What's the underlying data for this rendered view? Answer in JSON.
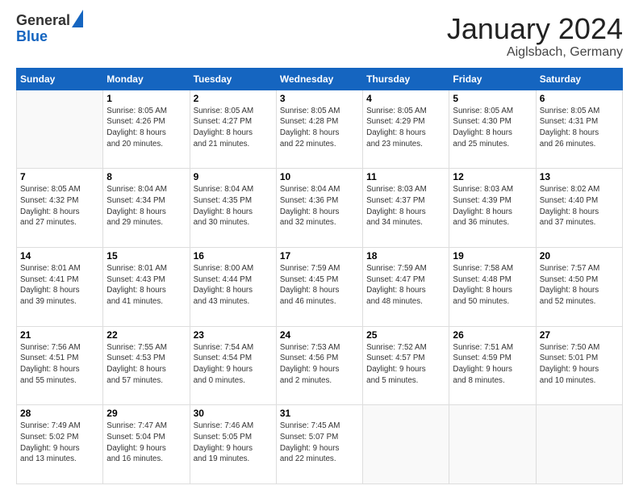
{
  "header": {
    "logo": {
      "general": "General",
      "blue": "Blue"
    },
    "title": "January 2024",
    "location": "Aiglsbach, Germany"
  },
  "weekdays": [
    "Sunday",
    "Monday",
    "Tuesday",
    "Wednesday",
    "Thursday",
    "Friday",
    "Saturday"
  ],
  "weeks": [
    [
      {
        "day": null,
        "info": null
      },
      {
        "day": "1",
        "info": "Sunrise: 8:05 AM\nSunset: 4:26 PM\nDaylight: 8 hours\nand 20 minutes."
      },
      {
        "day": "2",
        "info": "Sunrise: 8:05 AM\nSunset: 4:27 PM\nDaylight: 8 hours\nand 21 minutes."
      },
      {
        "day": "3",
        "info": "Sunrise: 8:05 AM\nSunset: 4:28 PM\nDaylight: 8 hours\nand 22 minutes."
      },
      {
        "day": "4",
        "info": "Sunrise: 8:05 AM\nSunset: 4:29 PM\nDaylight: 8 hours\nand 23 minutes."
      },
      {
        "day": "5",
        "info": "Sunrise: 8:05 AM\nSunset: 4:30 PM\nDaylight: 8 hours\nand 25 minutes."
      },
      {
        "day": "6",
        "info": "Sunrise: 8:05 AM\nSunset: 4:31 PM\nDaylight: 8 hours\nand 26 minutes."
      }
    ],
    [
      {
        "day": "7",
        "info": "Sunrise: 8:05 AM\nSunset: 4:32 PM\nDaylight: 8 hours\nand 27 minutes."
      },
      {
        "day": "8",
        "info": "Sunrise: 8:04 AM\nSunset: 4:34 PM\nDaylight: 8 hours\nand 29 minutes."
      },
      {
        "day": "9",
        "info": "Sunrise: 8:04 AM\nSunset: 4:35 PM\nDaylight: 8 hours\nand 30 minutes."
      },
      {
        "day": "10",
        "info": "Sunrise: 8:04 AM\nSunset: 4:36 PM\nDaylight: 8 hours\nand 32 minutes."
      },
      {
        "day": "11",
        "info": "Sunrise: 8:03 AM\nSunset: 4:37 PM\nDaylight: 8 hours\nand 34 minutes."
      },
      {
        "day": "12",
        "info": "Sunrise: 8:03 AM\nSunset: 4:39 PM\nDaylight: 8 hours\nand 36 minutes."
      },
      {
        "day": "13",
        "info": "Sunrise: 8:02 AM\nSunset: 4:40 PM\nDaylight: 8 hours\nand 37 minutes."
      }
    ],
    [
      {
        "day": "14",
        "info": "Sunrise: 8:01 AM\nSunset: 4:41 PM\nDaylight: 8 hours\nand 39 minutes."
      },
      {
        "day": "15",
        "info": "Sunrise: 8:01 AM\nSunset: 4:43 PM\nDaylight: 8 hours\nand 41 minutes."
      },
      {
        "day": "16",
        "info": "Sunrise: 8:00 AM\nSunset: 4:44 PM\nDaylight: 8 hours\nand 43 minutes."
      },
      {
        "day": "17",
        "info": "Sunrise: 7:59 AM\nSunset: 4:45 PM\nDaylight: 8 hours\nand 46 minutes."
      },
      {
        "day": "18",
        "info": "Sunrise: 7:59 AM\nSunset: 4:47 PM\nDaylight: 8 hours\nand 48 minutes."
      },
      {
        "day": "19",
        "info": "Sunrise: 7:58 AM\nSunset: 4:48 PM\nDaylight: 8 hours\nand 50 minutes."
      },
      {
        "day": "20",
        "info": "Sunrise: 7:57 AM\nSunset: 4:50 PM\nDaylight: 8 hours\nand 52 minutes."
      }
    ],
    [
      {
        "day": "21",
        "info": "Sunrise: 7:56 AM\nSunset: 4:51 PM\nDaylight: 8 hours\nand 55 minutes."
      },
      {
        "day": "22",
        "info": "Sunrise: 7:55 AM\nSunset: 4:53 PM\nDaylight: 8 hours\nand 57 minutes."
      },
      {
        "day": "23",
        "info": "Sunrise: 7:54 AM\nSunset: 4:54 PM\nDaylight: 9 hours\nand 0 minutes."
      },
      {
        "day": "24",
        "info": "Sunrise: 7:53 AM\nSunset: 4:56 PM\nDaylight: 9 hours\nand 2 minutes."
      },
      {
        "day": "25",
        "info": "Sunrise: 7:52 AM\nSunset: 4:57 PM\nDaylight: 9 hours\nand 5 minutes."
      },
      {
        "day": "26",
        "info": "Sunrise: 7:51 AM\nSunset: 4:59 PM\nDaylight: 9 hours\nand 8 minutes."
      },
      {
        "day": "27",
        "info": "Sunrise: 7:50 AM\nSunset: 5:01 PM\nDaylight: 9 hours\nand 10 minutes."
      }
    ],
    [
      {
        "day": "28",
        "info": "Sunrise: 7:49 AM\nSunset: 5:02 PM\nDaylight: 9 hours\nand 13 minutes."
      },
      {
        "day": "29",
        "info": "Sunrise: 7:47 AM\nSunset: 5:04 PM\nDaylight: 9 hours\nand 16 minutes."
      },
      {
        "day": "30",
        "info": "Sunrise: 7:46 AM\nSunset: 5:05 PM\nDaylight: 9 hours\nand 19 minutes."
      },
      {
        "day": "31",
        "info": "Sunrise: 7:45 AM\nSunset: 5:07 PM\nDaylight: 9 hours\nand 22 minutes."
      },
      {
        "day": null,
        "info": null
      },
      {
        "day": null,
        "info": null
      },
      {
        "day": null,
        "info": null
      }
    ]
  ]
}
